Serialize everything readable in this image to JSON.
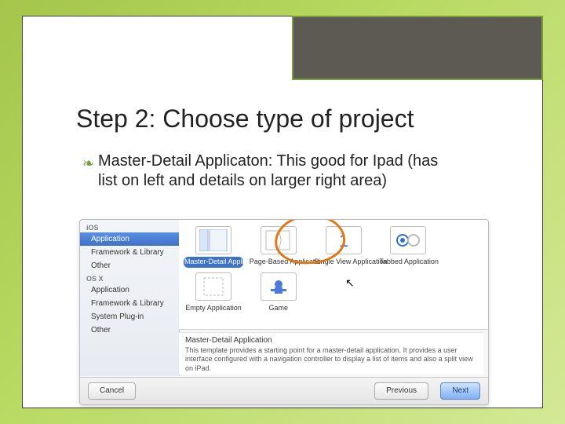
{
  "slide": {
    "title": "Step 2: Choose type of project",
    "bullet_text": "Master-Detail Applicaton: This good for Ipad (has list on left and details on larger right area)"
  },
  "dialog": {
    "sidebar": {
      "header1": "iOS",
      "items1": [
        "Application",
        "Framework & Library",
        "Other"
      ],
      "header2": "OS X",
      "items2": [
        "Application",
        "Framework & Library",
        "System Plug-in",
        "Other"
      ]
    },
    "templates_row1": [
      {
        "label": "Master-Detail Application",
        "selected": true
      },
      {
        "label": "Page-Based Application",
        "selected": false
      },
      {
        "label": "Single View Application",
        "selected": false
      },
      {
        "label": "Tabbed Application",
        "selected": false
      }
    ],
    "templates_row2": [
      {
        "label": "Empty Application",
        "selected": false
      },
      {
        "label": "Game",
        "selected": false
      }
    ],
    "desc": {
      "title": "Master-Detail Application",
      "body": "This template provides a starting point for a master-detail application. It provides a user interface configured with a navigation controller to display a list of items and also a split view on iPad."
    },
    "buttons": {
      "cancel": "Cancel",
      "prev": "Previous",
      "next": "Next"
    }
  }
}
